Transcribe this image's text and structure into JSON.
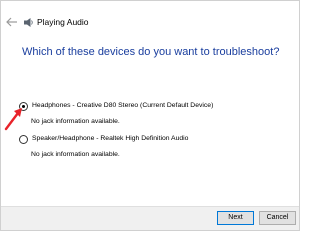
{
  "window": {
    "title": "Playing Audio",
    "title_icon": "speaker-icon",
    "back_icon": "back-arrow-icon"
  },
  "main": {
    "heading": "Which of these devices do you want to troubleshoot?",
    "options": [
      {
        "label": "Headphones - Creative D80 Stereo (Current Default Device)",
        "selected": true,
        "info": "No jack information available."
      },
      {
        "label": "Speaker/Headphone - Realtek High Definition Audio",
        "selected": false,
        "info": "No jack information available."
      }
    ]
  },
  "annotation": {
    "arrow_icon": "red-arrow-icon",
    "arrow_color": "#e8232a"
  },
  "footer": {
    "next_label": "Next",
    "cancel_label": "Cancel"
  },
  "colors": {
    "heading": "#1a3e9e",
    "footer_bg": "#f0f0f0",
    "primary_button_border": "#0078d7"
  }
}
